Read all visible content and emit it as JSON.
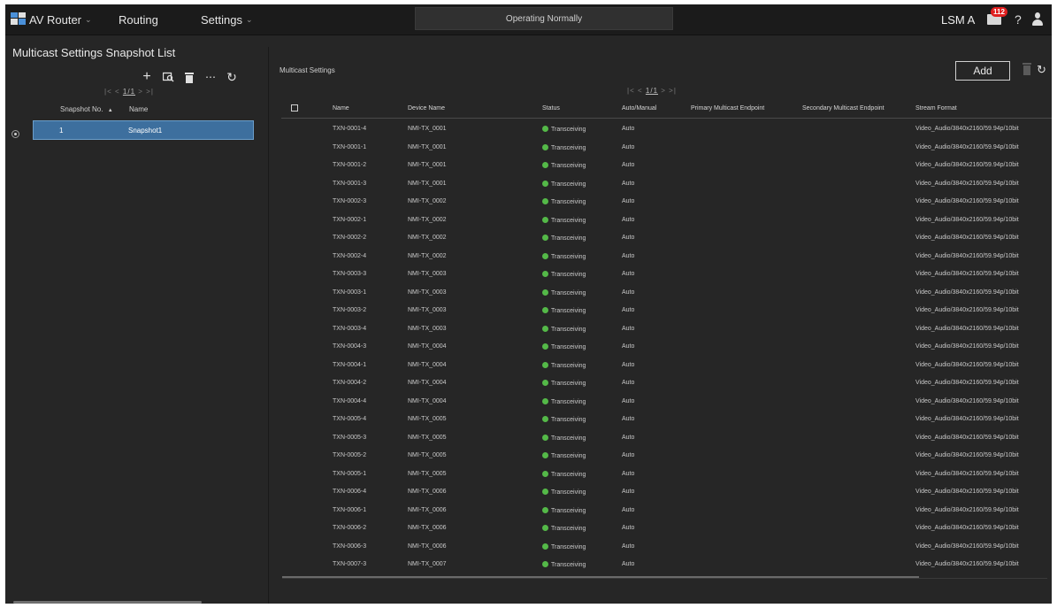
{
  "topbar": {
    "app_name": "AV Router",
    "nav": [
      "Routing",
      "Settings"
    ],
    "status": "Operating Normally",
    "user": "LSM A",
    "notification_count": "112",
    "help": "?"
  },
  "left": {
    "title": "Multicast Settings Snapshot List",
    "pager": "1/1",
    "columns": [
      "Snapshot No.",
      "Name"
    ],
    "sort_indicator": "▲",
    "rows": [
      {
        "no": "1",
        "name": "Snapshot1"
      }
    ]
  },
  "right": {
    "title": "Multicast Settings",
    "add_label": "Add",
    "pager": "1/1",
    "columns": [
      "Name",
      "Device Name",
      "Status",
      "Auto/Manual",
      "Primary Multicast Endpoint",
      "Secondary Multicast Endpoint",
      "Stream Format"
    ],
    "rows": [
      {
        "name": "TXN-0001-4",
        "device": "NMI-TX_0001",
        "status": "Transceiving",
        "mode": "Auto",
        "primary": "",
        "secondary": "",
        "format": "Video_Audio/3840x2160/59.94p/10bit"
      },
      {
        "name": "TXN-0001-1",
        "device": "NMI-TX_0001",
        "status": "Transceiving",
        "mode": "Auto",
        "primary": "",
        "secondary": "",
        "format": "Video_Audio/3840x2160/59.94p/10bit"
      },
      {
        "name": "TXN-0001-2",
        "device": "NMI-TX_0001",
        "status": "Transceiving",
        "mode": "Auto",
        "primary": "",
        "secondary": "",
        "format": "Video_Audio/3840x2160/59.94p/10bit"
      },
      {
        "name": "TXN-0001-3",
        "device": "NMI-TX_0001",
        "status": "Transceiving",
        "mode": "Auto",
        "primary": "",
        "secondary": "",
        "format": "Video_Audio/3840x2160/59.94p/10bit"
      },
      {
        "name": "TXN-0002-3",
        "device": "NMI-TX_0002",
        "status": "Transceiving",
        "mode": "Auto",
        "primary": "",
        "secondary": "",
        "format": "Video_Audio/3840x2160/59.94p/10bit"
      },
      {
        "name": "TXN-0002-1",
        "device": "NMI-TX_0002",
        "status": "Transceiving",
        "mode": "Auto",
        "primary": "",
        "secondary": "",
        "format": "Video_Audio/3840x2160/59.94p/10bit"
      },
      {
        "name": "TXN-0002-2",
        "device": "NMI-TX_0002",
        "status": "Transceiving",
        "mode": "Auto",
        "primary": "",
        "secondary": "",
        "format": "Video_Audio/3840x2160/59.94p/10bit"
      },
      {
        "name": "TXN-0002-4",
        "device": "NMI-TX_0002",
        "status": "Transceiving",
        "mode": "Auto",
        "primary": "",
        "secondary": "",
        "format": "Video_Audio/3840x2160/59.94p/10bit"
      },
      {
        "name": "TXN-0003-3",
        "device": "NMI-TX_0003",
        "status": "Transceiving",
        "mode": "Auto",
        "primary": "",
        "secondary": "",
        "format": "Video_Audio/3840x2160/59.94p/10bit"
      },
      {
        "name": "TXN-0003-1",
        "device": "NMI-TX_0003",
        "status": "Transceiving",
        "mode": "Auto",
        "primary": "",
        "secondary": "",
        "format": "Video_Audio/3840x2160/59.94p/10bit"
      },
      {
        "name": "TXN-0003-2",
        "device": "NMI-TX_0003",
        "status": "Transceiving",
        "mode": "Auto",
        "primary": "",
        "secondary": "",
        "format": "Video_Audio/3840x2160/59.94p/10bit"
      },
      {
        "name": "TXN-0003-4",
        "device": "NMI-TX_0003",
        "status": "Transceiving",
        "mode": "Auto",
        "primary": "",
        "secondary": "",
        "format": "Video_Audio/3840x2160/59.94p/10bit"
      },
      {
        "name": "TXN-0004-3",
        "device": "NMI-TX_0004",
        "status": "Transceiving",
        "mode": "Auto",
        "primary": "",
        "secondary": "",
        "format": "Video_Audio/3840x2160/59.94p/10bit"
      },
      {
        "name": "TXN-0004-1",
        "device": "NMI-TX_0004",
        "status": "Transceiving",
        "mode": "Auto",
        "primary": "",
        "secondary": "",
        "format": "Video_Audio/3840x2160/59.94p/10bit"
      },
      {
        "name": "TXN-0004-2",
        "device": "NMI-TX_0004",
        "status": "Transceiving",
        "mode": "Auto",
        "primary": "",
        "secondary": "",
        "format": "Video_Audio/3840x2160/59.94p/10bit"
      },
      {
        "name": "TXN-0004-4",
        "device": "NMI-TX_0004",
        "status": "Transceiving",
        "mode": "Auto",
        "primary": "",
        "secondary": "",
        "format": "Video_Audio/3840x2160/59.94p/10bit"
      },
      {
        "name": "TXN-0005-4",
        "device": "NMI-TX_0005",
        "status": "Transceiving",
        "mode": "Auto",
        "primary": "",
        "secondary": "",
        "format": "Video_Audio/3840x2160/59.94p/10bit"
      },
      {
        "name": "TXN-0005-3",
        "device": "NMI-TX_0005",
        "status": "Transceiving",
        "mode": "Auto",
        "primary": "",
        "secondary": "",
        "format": "Video_Audio/3840x2160/59.94p/10bit"
      },
      {
        "name": "TXN-0005-2",
        "device": "NMI-TX_0005",
        "status": "Transceiving",
        "mode": "Auto",
        "primary": "",
        "secondary": "",
        "format": "Video_Audio/3840x2160/59.94p/10bit"
      },
      {
        "name": "TXN-0005-1",
        "device": "NMI-TX_0005",
        "status": "Transceiving",
        "mode": "Auto",
        "primary": "",
        "secondary": "",
        "format": "Video_Audio/3840x2160/59.94p/10bit"
      },
      {
        "name": "TXN-0006-4",
        "device": "NMI-TX_0006",
        "status": "Transceiving",
        "mode": "Auto",
        "primary": "",
        "secondary": "",
        "format": "Video_Audio/3840x2160/59.94p/10bit"
      },
      {
        "name": "TXN-0006-1",
        "device": "NMI-TX_0006",
        "status": "Transceiving",
        "mode": "Auto",
        "primary": "",
        "secondary": "",
        "format": "Video_Audio/3840x2160/59.94p/10bit"
      },
      {
        "name": "TXN-0006-2",
        "device": "NMI-TX_0006",
        "status": "Transceiving",
        "mode": "Auto",
        "primary": "",
        "secondary": "",
        "format": "Video_Audio/3840x2160/59.94p/10bit"
      },
      {
        "name": "TXN-0006-3",
        "device": "NMI-TX_0006",
        "status": "Transceiving",
        "mode": "Auto",
        "primary": "",
        "secondary": "",
        "format": "Video_Audio/3840x2160/59.94p/10bit"
      },
      {
        "name": "TXN-0007-3",
        "device": "NMI-TX_0007",
        "status": "Transceiving",
        "mode": "Auto",
        "primary": "",
        "secondary": "",
        "format": "Video_Audio/3840x2160/59.94p/10bit"
      }
    ]
  },
  "icons": {
    "add": "plus-icon",
    "copy": "copy-icon",
    "delete": "trash-icon",
    "more": "more-icon",
    "refresh": "refresh-icon"
  },
  "colors": {
    "status_ok": "#54b948",
    "selected_row": "#3d6f9e",
    "badge": "#e01f1f"
  }
}
